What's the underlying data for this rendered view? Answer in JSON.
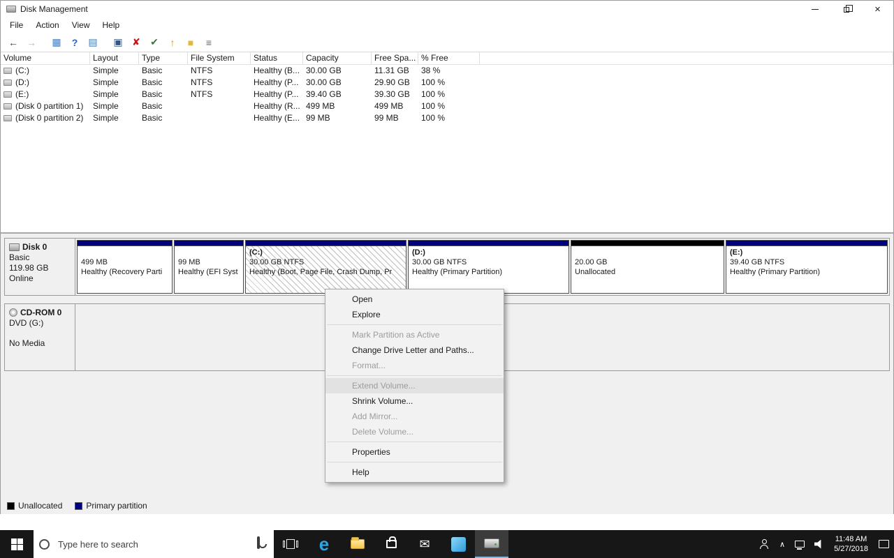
{
  "window": {
    "title": "Disk Management"
  },
  "menu": {
    "items": [
      "File",
      "Action",
      "View",
      "Help"
    ]
  },
  "icons": {
    "back": "←",
    "forward": "→",
    "grid1": "▦",
    "help": "?",
    "grid2": "▤",
    "console": "▣",
    "delete": "✘",
    "check": "✔",
    "up": "↑",
    "folder": "■",
    "list": "≡",
    "close": "×",
    "mail": "✉",
    "chevron_up": "∧"
  },
  "volume_table": {
    "columns": [
      "Volume",
      "Layout",
      "Type",
      "File System",
      "Status",
      "Capacity",
      "Free Spa...",
      "% Free"
    ],
    "rows": [
      {
        "volume": "(C:)",
        "layout": "Simple",
        "type": "Basic",
        "fs": "NTFS",
        "status": "Healthy (B...",
        "capacity": "30.00 GB",
        "free_space": "11.31 GB",
        "pct_free": "38 %"
      },
      {
        "volume": "(D:)",
        "layout": "Simple",
        "type": "Basic",
        "fs": "NTFS",
        "status": "Healthy (P...",
        "capacity": "30.00 GB",
        "free_space": "29.90 GB",
        "pct_free": "100 %"
      },
      {
        "volume": "(E:)",
        "layout": "Simple",
        "type": "Basic",
        "fs": "NTFS",
        "status": "Healthy (P...",
        "capacity": "39.40 GB",
        "free_space": "39.30 GB",
        "pct_free": "100 %"
      },
      {
        "volume": "(Disk 0 partition 1)",
        "layout": "Simple",
        "type": "Basic",
        "fs": "",
        "status": "Healthy (R...",
        "capacity": "499 MB",
        "free_space": "499 MB",
        "pct_free": "100 %"
      },
      {
        "volume": "(Disk 0 partition 2)",
        "layout": "Simple",
        "type": "Basic",
        "fs": "",
        "status": "Healthy (E...",
        "capacity": "99 MB",
        "free_space": "99 MB",
        "pct_free": "100 %"
      }
    ]
  },
  "disk0": {
    "name": "Disk 0",
    "type": "Basic",
    "size": "119.98 GB",
    "status": "Online",
    "partitions": [
      {
        "title": "",
        "line1": "499 MB",
        "line2": "Healthy (Recovery Parti"
      },
      {
        "title": "",
        "line1": "99 MB",
        "line2": "Healthy (EFI Syst"
      },
      {
        "title": "(C:)",
        "line1": "30.00 GB NTFS",
        "line2": "Healthy (Boot, Page File, Crash Dump, Pr"
      },
      {
        "title": "(D:)",
        "line1": "30.00 GB NTFS",
        "line2": "Healthy (Primary Partition)"
      },
      {
        "title": "",
        "line1": "20.00 GB",
        "line2": "Unallocated"
      },
      {
        "title": "(E:)",
        "line1": "39.40 GB NTFS",
        "line2": "Healthy (Primary Partition)"
      }
    ]
  },
  "cdrom": {
    "name": "CD-ROM 0",
    "media": "DVD (G:)",
    "status": "No Media"
  },
  "context_menu": {
    "items": [
      {
        "label": "Open",
        "disabled": false
      },
      {
        "label": "Explore",
        "disabled": false
      },
      {
        "label": "Mark Partition as Active",
        "disabled": true
      },
      {
        "label": "Change Drive Letter and Paths...",
        "disabled": false
      },
      {
        "label": "Format...",
        "disabled": true
      },
      {
        "label": "Extend Volume...",
        "disabled": true,
        "highlighted": true
      },
      {
        "label": "Shrink Volume...",
        "disabled": false
      },
      {
        "label": "Add Mirror...",
        "disabled": true
      },
      {
        "label": "Delete Volume...",
        "disabled": true
      },
      {
        "label": "Properties",
        "disabled": false
      },
      {
        "label": "Help",
        "disabled": false
      }
    ]
  },
  "legend": {
    "unallocated": "Unallocated",
    "primary": "Primary partition"
  },
  "taskbar": {
    "search_placeholder": "Type here to search",
    "time": "11:48 AM",
    "date": "5/27/2018"
  },
  "colors": {
    "partition_header": "#000082",
    "unallocated_header": "#000000",
    "taskbar_bg": "#171717",
    "edge_blue": "#2aa7e8"
  }
}
